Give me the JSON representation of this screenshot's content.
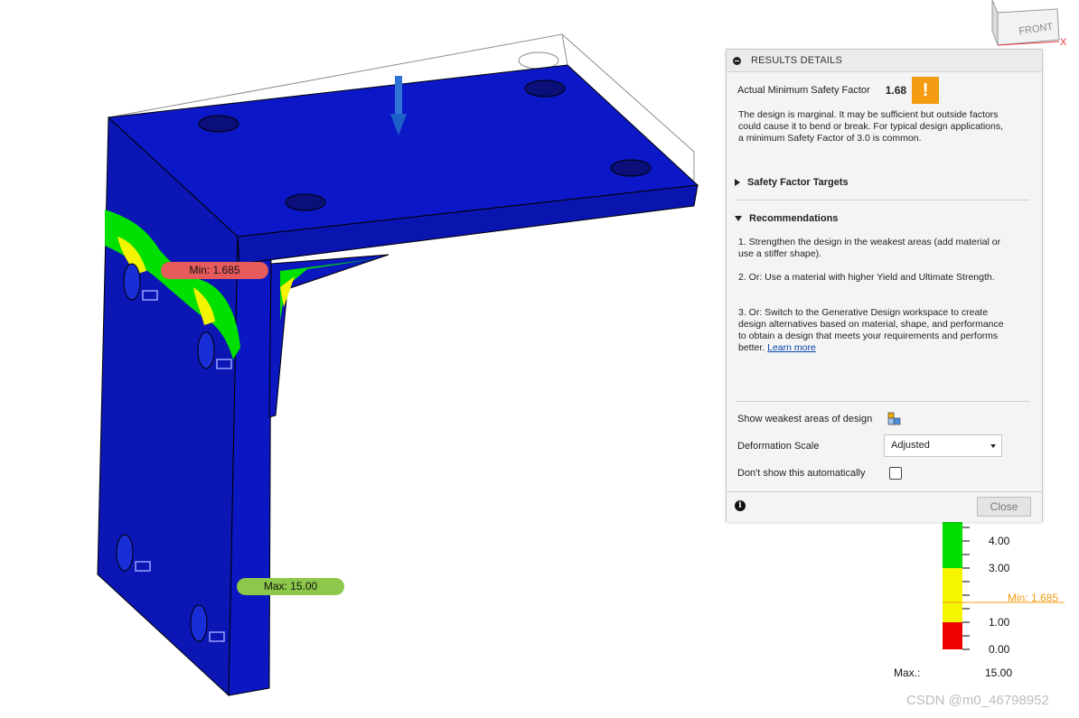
{
  "viewport": {
    "probe_min_label": "Min: 1.685",
    "probe_max_label": "Max: 15.00",
    "viewcube_face": "FRONT",
    "viewcube_axis_x": "X",
    "load_arrow_icon": "arrow-down-icon"
  },
  "results_panel": {
    "title": "RESULTS DETAILS",
    "safety_factor_label": "Actual Minimum Safety Factor",
    "safety_factor_value": "1.68",
    "warning_symbol": "!",
    "warning_color": "#f39c12",
    "description": "The design is marginal. It may be sufficient but outside factors could cause it to bend or break. For typical design applications, a minimum Safety Factor of 3.0 is common.",
    "safety_factor_targets": {
      "label": "Safety Factor Targets",
      "expanded": false
    },
    "recommendations": {
      "label": "Recommendations",
      "expanded": true,
      "items": [
        "1. Strengthen the design in the weakest areas (add material or use a stiffer shape).",
        "2. Or: Use a material with higher Yield and Ultimate Strength.",
        "3. Or: Switch to the Generative Design workspace to create design alternatives based on material, shape, and performance to obtain a design that meets your requirements and performs better."
      ],
      "learn_more": "Learn more"
    },
    "show_weakest_label": "Show weakest areas of design",
    "deformation_scale_label": "Deformation Scale",
    "deformation_scale_value": "Adjusted",
    "dont_show_label": "Don't show this automatically",
    "dont_show_checked": false,
    "close_label": "Close"
  },
  "legend": {
    "ticks": [
      "4.00",
      "3.00",
      "1.00",
      "0.00"
    ],
    "min_marker": "Min: 1.685",
    "max_label": "Max.:",
    "max_value": "15.00",
    "colors": {
      "green": "#00dd00",
      "yellow": "#f5f500",
      "red": "#ee0000",
      "marker": "#f39c12"
    }
  },
  "watermark": "CSDN @m0_46798952"
}
